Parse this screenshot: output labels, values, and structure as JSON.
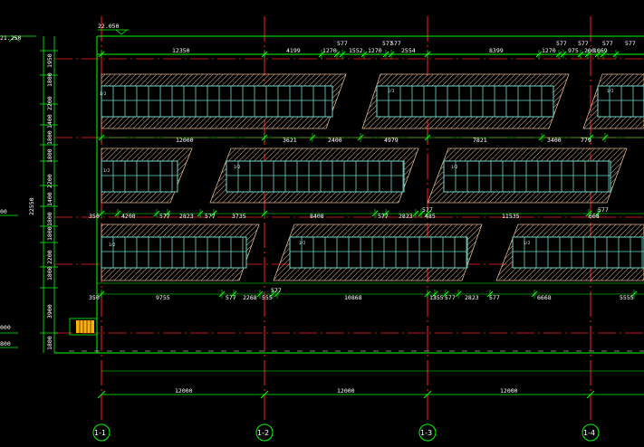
{
  "drawing": {
    "background": "#000000",
    "colors": {
      "wall": "#00ff00",
      "axis": "#ff0000",
      "window": "#6fd6c8",
      "hatch": "#e0c09a",
      "dim_tick": "#00ff00",
      "text": "#ffffff",
      "stair": "#ffb000"
    },
    "elevation_marks": {
      "top": "22.050",
      "left_top": "21.250",
      "left_mid": "00",
      "left_low": "000",
      "left_bottom": "800"
    },
    "overall_height": "22550",
    "left_dims": [
      "1950",
      "1800",
      "2200",
      "1400",
      "1800",
      "1800",
      "2200",
      "1400",
      "1800",
      "1800",
      "2200",
      "1800",
      "3900",
      "1800"
    ],
    "row_dims": [
      [
        "12350",
        "4199",
        "577",
        "1270",
        "577",
        "1552",
        "1270",
        "577",
        "2554",
        "8399",
        "577",
        "1270",
        "577",
        "975",
        "577",
        "200",
        "1069",
        "577"
      ],
      [
        "12000",
        "3621",
        "2400",
        "4979",
        "7821",
        "3400",
        "779"
      ],
      [
        "350",
        "4208",
        "577",
        "2823",
        "577",
        "3735",
        "8408",
        "577",
        "2823",
        "577",
        "485",
        "11535",
        "577",
        "668"
      ],
      [
        "350",
        "9755",
        "577",
        "2268",
        "577",
        "555",
        "10868",
        "1355",
        "577",
        "2823",
        "577",
        "6668",
        "5555"
      ]
    ],
    "tags": [
      "1/2",
      "1/2",
      "1/2",
      "1/2",
      "1/2",
      "1/2",
      "1/2",
      "1/2",
      "1/2"
    ],
    "bay_dims": [
      "12000",
      "12000",
      "12000"
    ],
    "axes": [
      "1-1",
      "1-2",
      "1-3",
      "1-4"
    ]
  }
}
